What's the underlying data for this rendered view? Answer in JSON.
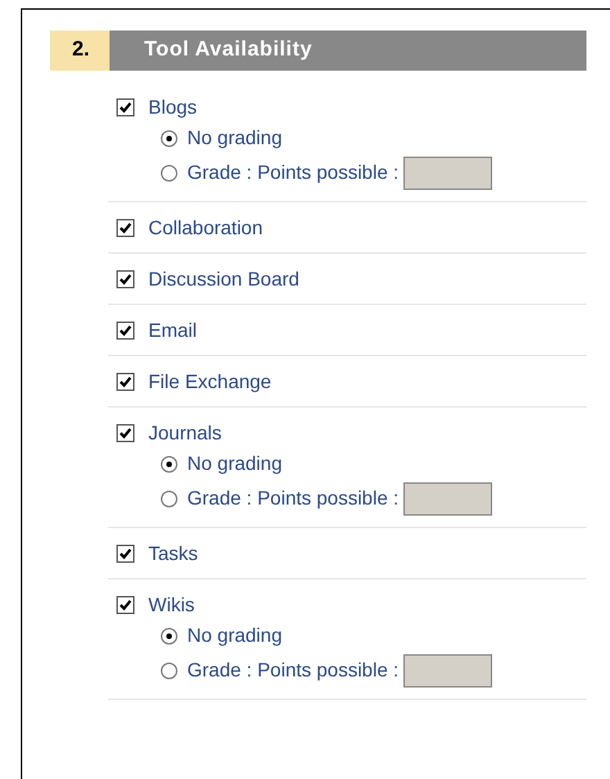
{
  "section": {
    "number": "2.",
    "title": "Tool Availability"
  },
  "tools": [
    {
      "label": "Blogs",
      "checked": true,
      "options": [
        {
          "label": "No grading",
          "selected": true,
          "kind": "plain"
        },
        {
          "label": "Grade : Points possible :",
          "selected": false,
          "kind": "points"
        }
      ]
    },
    {
      "label": "Collaboration",
      "checked": true
    },
    {
      "label": "Discussion Board",
      "checked": true
    },
    {
      "label": "Email",
      "checked": true
    },
    {
      "label": "File Exchange",
      "checked": true
    },
    {
      "label": "Journals",
      "checked": true,
      "options": [
        {
          "label": "No grading",
          "selected": true,
          "kind": "plain"
        },
        {
          "label": "Grade : Points possible :",
          "selected": false,
          "kind": "points"
        }
      ]
    },
    {
      "label": "Tasks",
      "checked": true
    },
    {
      "label": "Wikis",
      "checked": true,
      "options": [
        {
          "label": "No grading",
          "selected": true,
          "kind": "plain"
        },
        {
          "label": "Grade : Points possible :",
          "selected": false,
          "kind": "points"
        }
      ]
    }
  ]
}
